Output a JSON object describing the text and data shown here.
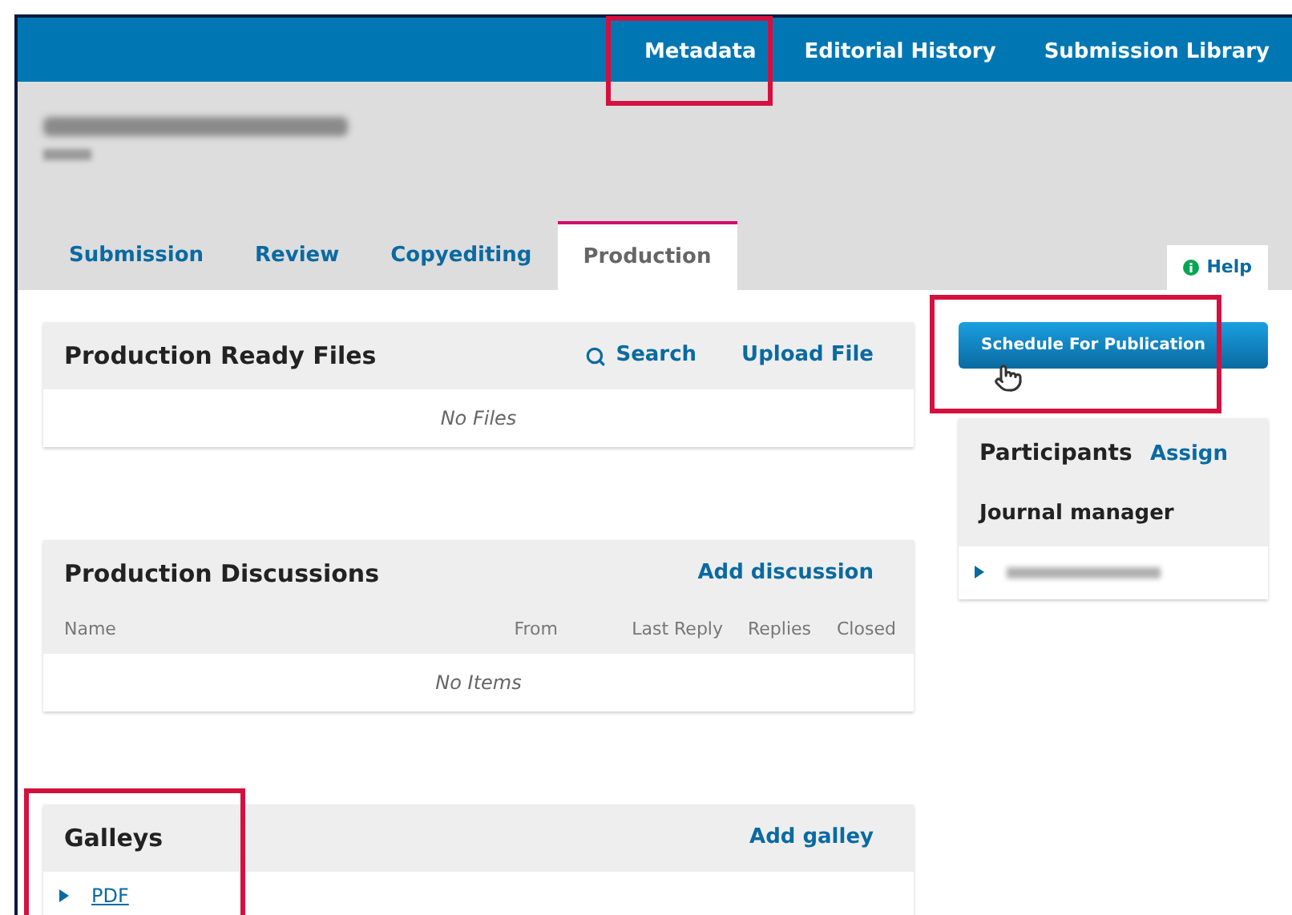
{
  "top_nav": [
    {
      "label": "Metadata",
      "highlighted": true
    },
    {
      "label": "Editorial History",
      "highlighted": false
    },
    {
      "label": "Submission Library",
      "highlighted": false
    }
  ],
  "tabs": [
    {
      "label": "Submission",
      "selected": false
    },
    {
      "label": "Review",
      "selected": false
    },
    {
      "label": "Copyediting",
      "selected": false
    },
    {
      "label": "Production",
      "selected": true
    }
  ],
  "help": {
    "label": "Help"
  },
  "panels": [
    {
      "kind": "files",
      "title": "Production Ready Files",
      "actions": [
        {
          "label": "Search",
          "kind": "search"
        },
        {
          "label": "Upload File"
        }
      ],
      "empty": "No Files",
      "highlighted": false
    },
    {
      "kind": "discussions",
      "title": "Production Discussions",
      "actions": [
        {
          "label": "Add discussion"
        }
      ],
      "columns": [
        "Name",
        "From",
        "Last Reply",
        "Replies",
        "Closed"
      ],
      "empty": "No Items",
      "highlighted": false
    },
    {
      "kind": "galleys",
      "title": "Galleys",
      "actions": [
        {
          "label": "Add galley"
        }
      ],
      "items": [
        {
          "label": "PDF"
        }
      ],
      "highlighted": true
    }
  ],
  "schedule_button": {
    "label": "Schedule For Publication",
    "highlighted": true
  },
  "participants": {
    "title": "Participants",
    "action": "Assign",
    "groups": [
      {
        "name": "Journal manager"
      }
    ]
  }
}
